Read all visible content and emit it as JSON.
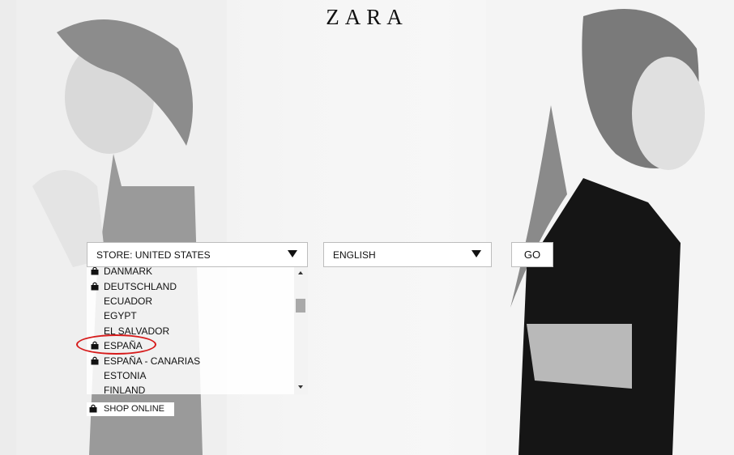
{
  "brand": {
    "logo": "ZARA"
  },
  "store_select": {
    "label": "STORE: UNITED STATES",
    "icon": "chevron-down-icon"
  },
  "language_select": {
    "label": "ENGLISH",
    "icon": "chevron-down-icon"
  },
  "go_button": {
    "label": "GO"
  },
  "country_list": {
    "items": [
      {
        "name": "DANMARK",
        "shop_online": true
      },
      {
        "name": "DEUTSCHLAND",
        "shop_online": true
      },
      {
        "name": "ECUADOR",
        "shop_online": false
      },
      {
        "name": "EGYPT",
        "shop_online": false
      },
      {
        "name": "EL SALVADOR",
        "shop_online": false
      },
      {
        "name": "ESPAÑA",
        "shop_online": true
      },
      {
        "name": "ESPAÑA - CANARIAS",
        "shop_online": true
      },
      {
        "name": "ESTONIA",
        "shop_online": false
      },
      {
        "name": "FINLAND",
        "shop_online": false
      }
    ],
    "highlighted": "ESPAÑA"
  },
  "legend": {
    "shop_online": "SHOP ONLINE",
    "icon": "shopping-bag-icon"
  },
  "colors": {
    "highlight": "#d61b1b",
    "text": "#111111",
    "panel": "#ffffff"
  }
}
